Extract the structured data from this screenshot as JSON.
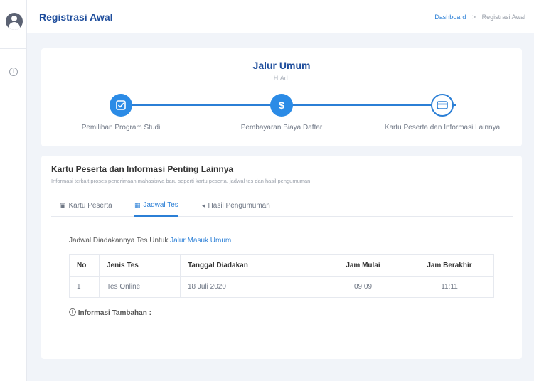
{
  "header": {
    "title": "Registrasi Awal",
    "breadcrumb": [
      "Dashboard",
      "Registrasi Awal"
    ],
    "breadcrumb_separator": ">"
  },
  "sidebar": {
    "icons": [
      "user-avatar",
      "info-circle-icon"
    ]
  },
  "steps_card": {
    "title": "Jalur Umum",
    "subtitle": "H.Ad.",
    "steps": [
      {
        "label": "Pemilihan Program Studi",
        "icon": "check-square-icon",
        "state": "done"
      },
      {
        "label": "Pembayaran Biaya Daftar",
        "icon": "dollar-icon",
        "state": "done"
      },
      {
        "label": "Kartu Peserta dan Informasi Lainnya",
        "icon": "card-icon",
        "state": "current"
      }
    ]
  },
  "info_card": {
    "title": "Kartu Peserta dan Informasi Penting Lainnya",
    "description": "Informasi terkait proses penerimaan mahasiswa baru seperti kartu peserta, jadwal tes dan hasil pengumuman",
    "tabs": [
      {
        "label": "Kartu Peserta",
        "icon": "id-card-icon",
        "active": false
      },
      {
        "label": "Jadwal Tes",
        "icon": "calendar-icon",
        "active": true
      },
      {
        "label": "Hasil Pengumuman",
        "icon": "megaphone-icon",
        "active": false
      }
    ],
    "schedule_prefix": "Jadwal Diadakannya Tes Untuk",
    "schedule_link": "Jalur Masuk Umum",
    "table": {
      "headers": [
        "No",
        "Jenis Tes",
        "Tanggal Diadakan",
        "Jam Mulai",
        "Jam Berakhir"
      ],
      "rows": [
        [
          "1",
          "Tes Online",
          "18 Juli 2020",
          "09:09",
          "11:11"
        ]
      ]
    },
    "additional_info": "ⓘ Informasi Tambahan :"
  },
  "colors": {
    "accent": "#2b7fd6",
    "title": "#1e4d9c",
    "background": "#f1f4f9"
  }
}
